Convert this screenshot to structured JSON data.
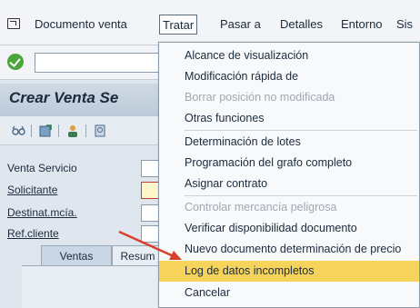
{
  "menubar": {
    "items": [
      {
        "label": "Documento venta"
      },
      {
        "label": "Tratar"
      },
      {
        "label": "Pasar a"
      },
      {
        "label": "Detalles"
      },
      {
        "label": "Entorno"
      },
      {
        "label": "Sis"
      }
    ]
  },
  "toolbar": {
    "command_value": ""
  },
  "titlebar": {
    "title": "Crear Venta Se"
  },
  "form": {
    "fields": [
      {
        "label": "Venta Servicio",
        "value": ""
      },
      {
        "label": "Solicitante",
        "value": ""
      },
      {
        "label": "Destinat.mcía.",
        "value": ""
      },
      {
        "label": "Ref.cliente",
        "value": ""
      }
    ],
    "tabs": [
      {
        "label": "Ventas"
      },
      {
        "label": "Resum"
      }
    ]
  },
  "dropdown": {
    "items": [
      {
        "label": "Alcance de visualización",
        "enabled": true
      },
      {
        "label": "Modificación rápida de",
        "enabled": true
      },
      {
        "label": "Borrar posición no modificada",
        "enabled": false
      },
      {
        "label": "Otras funciones",
        "enabled": true
      },
      {
        "label": "Determinación de lotes",
        "enabled": true
      },
      {
        "label": "Programación del grafo completo",
        "enabled": true
      },
      {
        "label": "Asignar contrato",
        "enabled": true
      },
      {
        "label": "Controlar mercancía peligrosa",
        "enabled": false
      },
      {
        "label": "Verificar disponibilidad documento",
        "enabled": true
      },
      {
        "label": "Nuevo documento determinación de precio",
        "enabled": true
      },
      {
        "label": "Log de datos incompletos",
        "enabled": true,
        "highlighted": true
      },
      {
        "label": "Cancelar",
        "enabled": true
      }
    ]
  },
  "colors": {
    "highlight": "#f6d35a",
    "arrow": "#d9402b",
    "ok_icon": "#4aa53a",
    "title_bg": "#c6d2de"
  }
}
